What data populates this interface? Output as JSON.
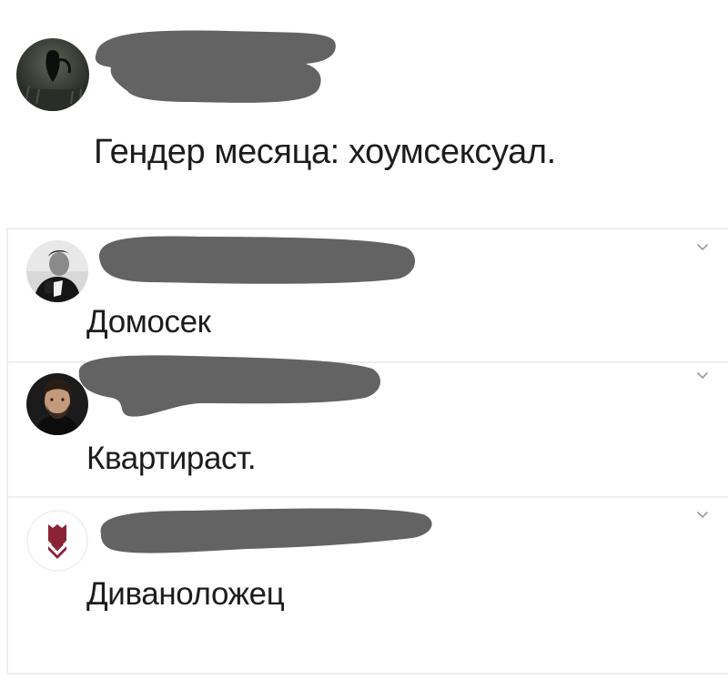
{
  "post": {
    "author_redacted": true,
    "text": "Гендер месяца: хоумсексуал."
  },
  "comments": [
    {
      "author_redacted": true,
      "text": "Домосек"
    },
    {
      "author_redacted": true,
      "text": "Квартираст."
    },
    {
      "author_redacted": true,
      "text": "Диваноложец"
    }
  ],
  "colors": {
    "redaction": "#636363",
    "text": "#1c1c1c",
    "divider": "#eeeeee",
    "chevron": "#9a9a9a",
    "brand_badge": "#8a2435"
  },
  "icons": {
    "comment_menu": "chevron-down-icon"
  }
}
